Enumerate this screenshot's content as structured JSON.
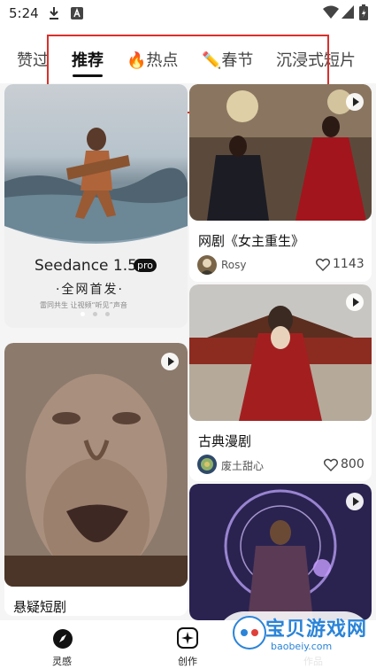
{
  "status_bar": {
    "time": "5:24",
    "icons": [
      "download-icon",
      "app-a-icon",
      "wifi-icon",
      "signal-icon",
      "battery-icon"
    ]
  },
  "tabs": [
    {
      "label": "赞过",
      "active": false
    },
    {
      "label": "推荐",
      "active": true
    },
    {
      "label": "🔥热点",
      "active": false
    },
    {
      "label": "✏️春节",
      "active": false
    },
    {
      "label": "沉浸式短片",
      "active": false
    }
  ],
  "banner": {
    "title": "Seedance 1.5",
    "badge": "pro",
    "subtitle": "·全网首发·",
    "note": "雷同共生  让视频“听见”声音",
    "dots": 3,
    "active_dot": 0
  },
  "feed": {
    "left": [
      {
        "title": "悬疑短剧",
        "has_play": true
      }
    ],
    "right": [
      {
        "title": "网剧《女主重生》",
        "author": "Rosy",
        "likes": "1143",
        "has_play": true
      },
      {
        "title": "古典漫剧",
        "author": "废土甜心",
        "likes": "800",
        "has_play": true
      },
      {
        "title": "",
        "has_play": true
      }
    ]
  },
  "bottom_nav": [
    {
      "label": "灵感",
      "icon": "compass-icon"
    },
    {
      "label": "创作",
      "icon": "sparkle-create-icon"
    },
    {
      "label": "作品",
      "icon": "works-icon"
    }
  ],
  "watermark": {
    "title": "宝贝游戏网",
    "url": "baobeiy.com"
  },
  "colors": {
    "accent_red": "#d9302b",
    "watermark_blue": "#2a84d8"
  }
}
